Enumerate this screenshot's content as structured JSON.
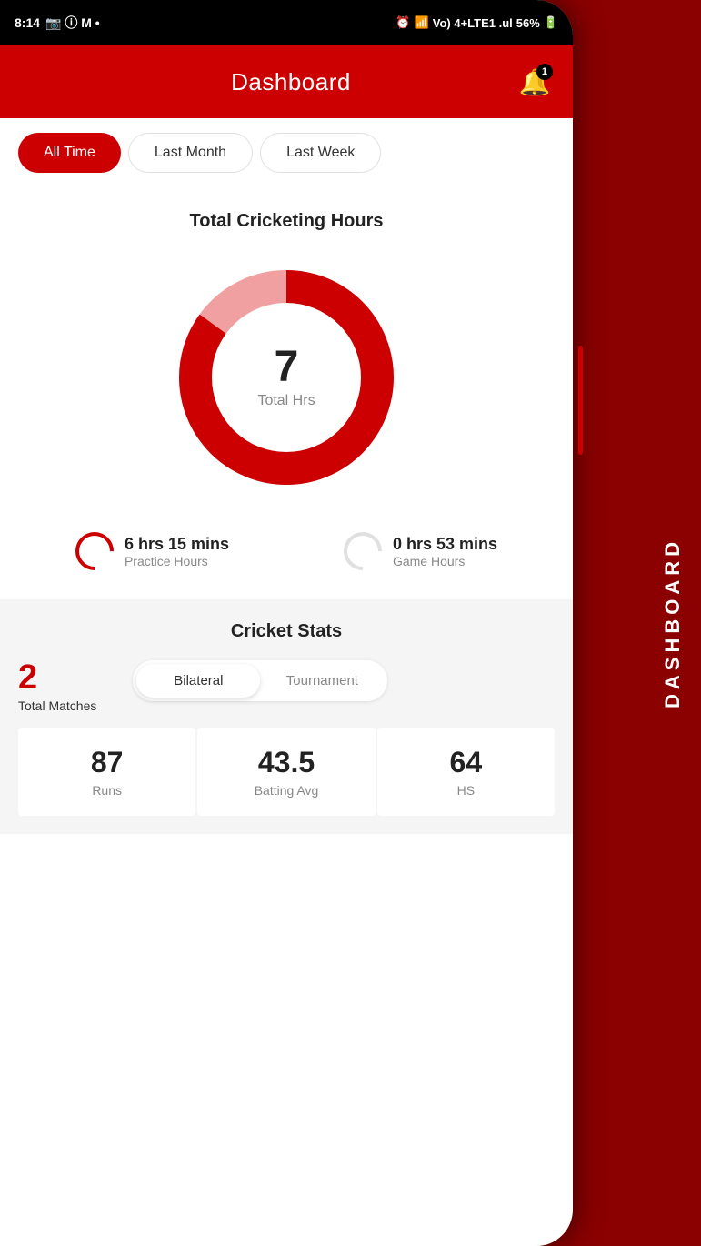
{
  "status_bar": {
    "time": "8:14",
    "battery": "56%",
    "signal": "Vo) 4+LTE1 .ul"
  },
  "header": {
    "title": "Dashboard",
    "notification_badge": "1"
  },
  "filter_tabs": {
    "tabs": [
      {
        "label": "All Time",
        "active": true
      },
      {
        "label": "Last Month",
        "active": false
      },
      {
        "label": "Last Week",
        "active": false
      }
    ]
  },
  "cricket_hours": {
    "title": "Total Cricketing Hours",
    "donut": {
      "total": "7",
      "label": "Total Hrs",
      "red_percent": 85,
      "pink_percent": 15
    },
    "practice": {
      "value": "6 hrs 15 mins",
      "label": "Practice Hours"
    },
    "game": {
      "value": "0 hrs 53 mins",
      "label": "Game Hours"
    }
  },
  "cricket_stats": {
    "title": "Cricket Stats",
    "total_matches": {
      "number": "2",
      "label": "Total Matches"
    },
    "match_types": [
      {
        "label": "Bilateral",
        "active": true
      },
      {
        "label": "Tournament",
        "active": false
      }
    ],
    "stats": [
      {
        "value": "87",
        "label": "Runs"
      },
      {
        "value": "43.5",
        "label": "Batting Avg"
      },
      {
        "value": "64",
        "label": "HS"
      }
    ]
  },
  "side_label": "DASHBOARD",
  "colors": {
    "primary": "#cc0000",
    "text_dark": "#222",
    "text_gray": "#888"
  }
}
